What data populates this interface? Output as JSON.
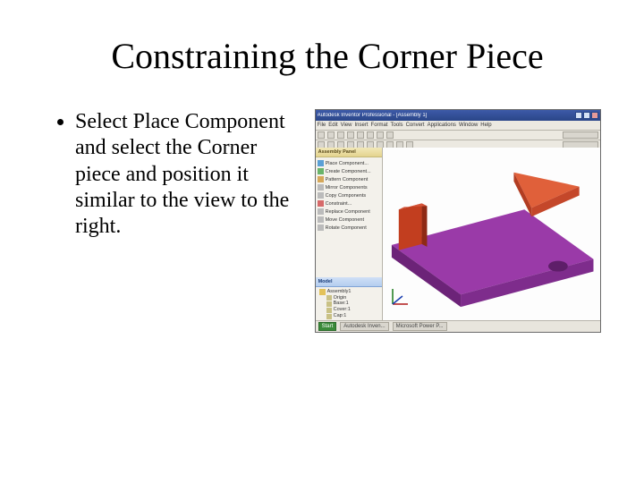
{
  "slide": {
    "title": "Constraining the Corner Piece",
    "bullets": [
      "Select Place Component and select the Corner piece and position it similar to the view to the right."
    ]
  },
  "screenshot": {
    "window_title": "Autodesk Inventor Professional - [Assembly 1]",
    "menubar": [
      "File",
      "Edit",
      "View",
      "Insert",
      "Format",
      "Tools",
      "Convert",
      "Applications",
      "Window",
      "Help"
    ],
    "panel1": {
      "header": "Assembly Panel",
      "items": [
        "Place Component...",
        "Create Component...",
        "Pattern Component",
        "Mirror Components",
        "Copy Components",
        "Constraint...",
        "Replace Component",
        "Move Component",
        "Rotate Component"
      ]
    },
    "panel2": {
      "header": "Model",
      "root": "Assembly1",
      "nodes": [
        "Origin",
        "Base:1",
        "Cover:1",
        "Cap:1"
      ]
    },
    "statusbar": [
      "Start",
      "Autodesk Inven...",
      "Microsoft Power P..."
    ],
    "colors": {
      "base": "#9a3aa8",
      "base_shade": "#7e2c8c",
      "corner": "#e0603a",
      "corner_shade": "#c4472a",
      "side": "#c23e1f"
    }
  }
}
